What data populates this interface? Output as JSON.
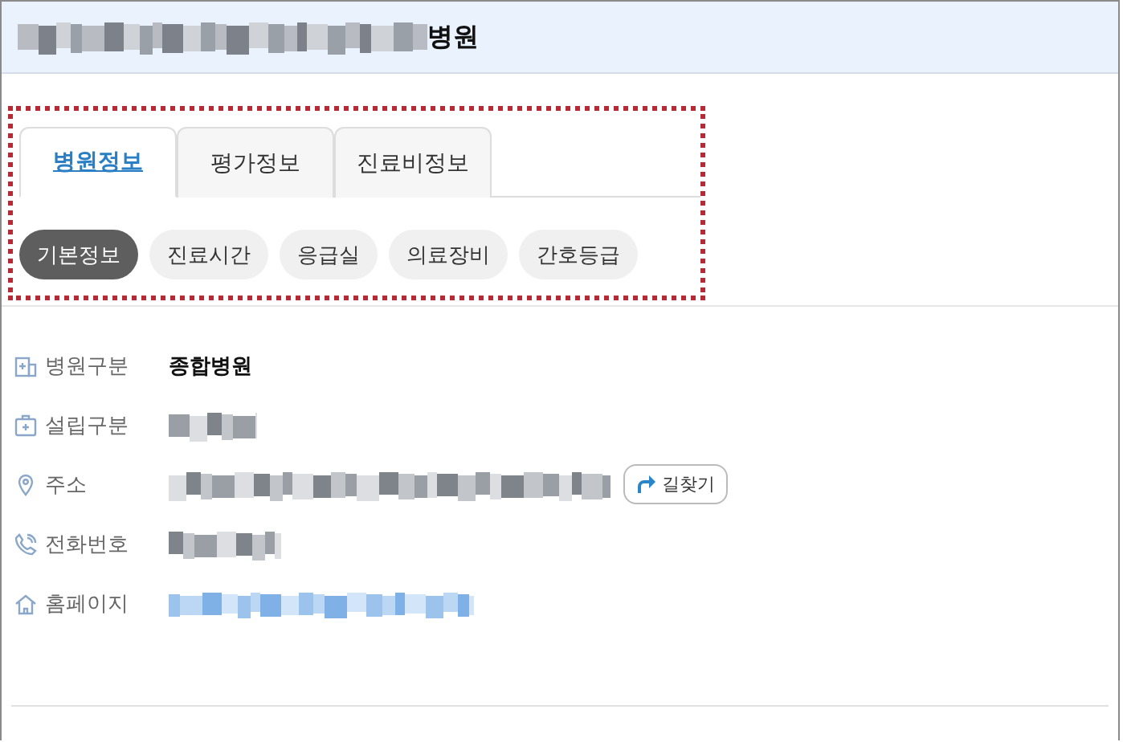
{
  "header": {
    "title_redacted": true,
    "title": "병원"
  },
  "tabs": [
    {
      "label": "병원정보",
      "selected": true
    },
    {
      "label": "평가정보",
      "selected": false
    },
    {
      "label": "진료비정보",
      "selected": false
    }
  ],
  "chips": [
    {
      "label": "기본정보",
      "selected": true
    },
    {
      "label": "진료시간",
      "selected": false
    },
    {
      "label": "응급실",
      "selected": false
    },
    {
      "label": "의료장비",
      "selected": false
    },
    {
      "label": "간호등급",
      "selected": false
    }
  ],
  "highlight": true,
  "info": [
    {
      "label": "병원구분",
      "kind": "text",
      "value": "종합병원"
    },
    {
      "label": "설립구분",
      "kind": "redacted"
    },
    {
      "label": "주소",
      "kind": "redacted",
      "button": "길찾기"
    },
    {
      "label": "전화번호",
      "kind": "redacted"
    },
    {
      "label": "홈페이지",
      "kind": "redacted-link"
    }
  ]
}
